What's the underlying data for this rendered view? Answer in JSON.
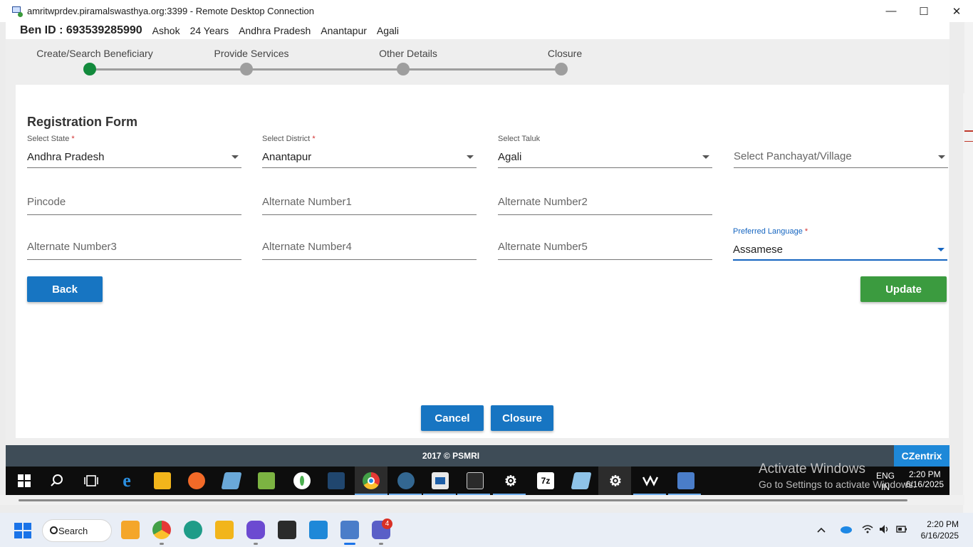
{
  "window": {
    "title": "amritwprdev.piramalswasthya.org:3399 - Remote Desktop Connection",
    "minimize_glyph": "—",
    "maximize_glyph": "☐",
    "close_glyph": "✕"
  },
  "beneficiary": {
    "id_label": "Ben ID : 693539285990",
    "name": "Ashok",
    "age": "24 Years",
    "state": "Andhra Pradesh",
    "district": "Anantapur",
    "taluk": "Agali"
  },
  "stepper": {
    "steps": [
      {
        "label": "Create/Search Beneficiary",
        "state": "active"
      },
      {
        "label": "Provide Services",
        "state": "inactive"
      },
      {
        "label": "Other Details",
        "state": "inactive"
      },
      {
        "label": "Closure",
        "state": "inactive"
      }
    ]
  },
  "form": {
    "title": "Registration Form",
    "state": {
      "label": "Select State",
      "value": "Andhra Pradesh"
    },
    "district": {
      "label": "Select District",
      "value": "Anantapur"
    },
    "taluk": {
      "label": "Select Taluk",
      "value": "Agali"
    },
    "village": {
      "placeholder": "Select Panchayat/Village"
    },
    "pincode": {
      "placeholder": "Pincode"
    },
    "alt1": {
      "placeholder": "Alternate Number1"
    },
    "alt2": {
      "placeholder": "Alternate Number2"
    },
    "alt3": {
      "placeholder": "Alternate Number3"
    },
    "alt4": {
      "placeholder": "Alternate Number4"
    },
    "alt5": {
      "placeholder": "Alternate Number5"
    },
    "language": {
      "label": "Preferred Language",
      "value": "Assamese"
    },
    "required_mark": "*",
    "back_label": "Back",
    "update_label": "Update",
    "cancel_label": "Cancel",
    "closure_label": "Closure"
  },
  "footer": {
    "copyright": "2017 © PSMRI",
    "brand": "CZentrix"
  },
  "inner_taskbar": {
    "activate_line1": "Activate Windows",
    "activate_line2": "Go to Settings to activate Windows.",
    "lang_top": "ENG",
    "lang_bottom": "IN",
    "time": "2:20 PM",
    "date": "6/16/2025"
  },
  "taskbar": {
    "search_label": "Search",
    "teams_badge": "4",
    "time": "2:20 PM",
    "date": "6/16/2025"
  },
  "colors": {
    "primary_blue": "#1775c2",
    "update_green": "#3b9b3f",
    "active_step": "#128a3c",
    "footer_bg": "#3e4c57",
    "brand_blue": "#1e88d8"
  }
}
